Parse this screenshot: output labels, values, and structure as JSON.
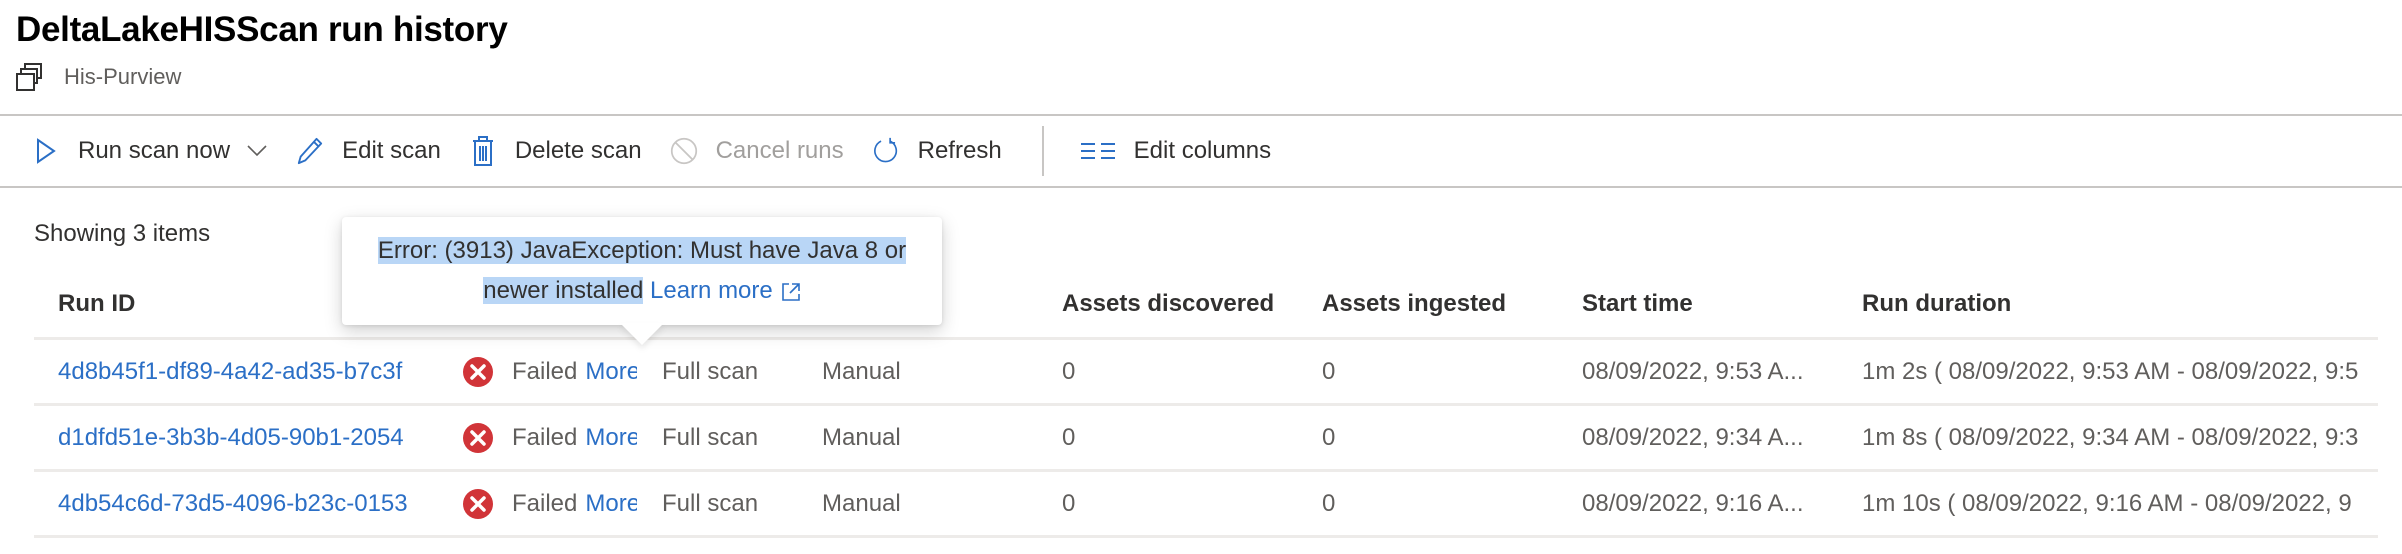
{
  "header": {
    "title": "DeltaLakeHISScan run history",
    "subtitle": "His-Purview",
    "subtitle_icon": "collection-icon"
  },
  "toolbar": {
    "run_scan_now": "Run scan now",
    "edit_scan": "Edit scan",
    "delete_scan": "Delete scan",
    "cancel_runs": "Cancel runs",
    "refresh": "Refresh",
    "edit_columns": "Edit columns"
  },
  "showing": "Showing 3 items",
  "tooltip": {
    "error_line1": "Error: (3913) JavaException: Must have Java 8 or",
    "error_line2": "newer installed",
    "learn_more": "Learn more"
  },
  "table": {
    "columns": {
      "run_id": "Run ID",
      "assets_discovered": "Assets discovered",
      "assets_ingested": "Assets ingested",
      "start_time": "Start time",
      "run_duration": "Run duration"
    },
    "rows": [
      {
        "run_id": "4d8b45f1-df89-4a42-ad35-b7c3f",
        "status": "Failed",
        "more": "More",
        "scan_type": "Full scan",
        "trigger": "Manual",
        "assets_discovered": "0",
        "assets_ingested": "0",
        "start_time": "08/09/2022, 9:53 A...",
        "run_duration": "1m 2s ( 08/09/2022, 9:53 AM - 08/09/2022, 9:5"
      },
      {
        "run_id": "d1dfd51e-3b3b-4d05-90b1-2054",
        "status": "Failed",
        "more": "More",
        "scan_type": "Full scan",
        "trigger": "Manual",
        "assets_discovered": "0",
        "assets_ingested": "0",
        "start_time": "08/09/2022, 9:34 A...",
        "run_duration": "1m 8s ( 08/09/2022, 9:34 AM - 08/09/2022, 9:3"
      },
      {
        "run_id": "4db54c6d-73d5-4096-b23c-0153",
        "status": "Failed",
        "more": "More",
        "scan_type": "Full scan",
        "trigger": "Manual",
        "assets_discovered": "0",
        "assets_ingested": "0",
        "start_time": "08/09/2022, 9:16 A...",
        "run_duration": "1m 10s ( 08/09/2022, 9:16 AM - 08/09/2022, 9"
      }
    ]
  },
  "colors": {
    "accent": "#2b6fc6",
    "error": "#d13438",
    "selection": "#b9d6f6"
  }
}
